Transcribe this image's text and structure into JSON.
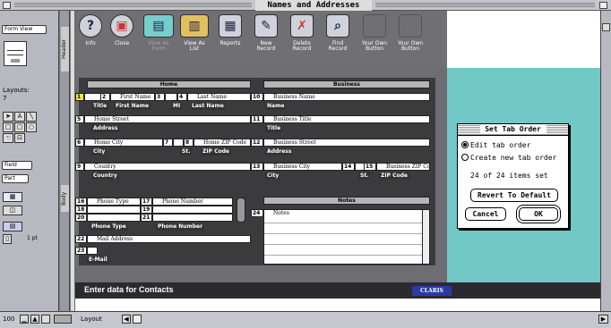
{
  "window": {
    "title": "Names and Addresses"
  },
  "left_panel": {
    "mode_popup": "Form View",
    "layouts_label": "Layouts:",
    "layouts_count": "7",
    "field_popup": "Field",
    "part_popup": "Part",
    "line_width": "1 pt"
  },
  "vertical_labels": {
    "header": "Header",
    "body": "Body"
  },
  "toolbar": {
    "buttons": [
      {
        "label": "Info",
        "icon": "?"
      },
      {
        "label": "Close",
        "icon": "▣"
      },
      {
        "label": "View As\nForm",
        "icon": "▤"
      },
      {
        "label": "View As\nList",
        "icon": "▥"
      },
      {
        "label": "Reports",
        "icon": "▦"
      },
      {
        "label": "New\nRecord",
        "icon": "✎"
      },
      {
        "label": "Delete\nRecord",
        "icon": "✗"
      },
      {
        "label": "Find\nRecord",
        "icon": "⌕"
      },
      {
        "label": "Your Own\nButton",
        "icon": ""
      },
      {
        "label": "Your Own\nButton",
        "icon": ""
      }
    ]
  },
  "form": {
    "home_header": "Home",
    "business_header": "Business",
    "notes_header": "Notes",
    "fields": {
      "f1": {
        "num": "1",
        "text": ""
      },
      "f2": {
        "num": "2",
        "text": "First Name"
      },
      "f3": {
        "num": "3",
        "text": ""
      },
      "f4": {
        "num": "4",
        "text": "Last Name"
      },
      "f5": {
        "num": "5",
        "text": "Home Street"
      },
      "f6": {
        "num": "6",
        "text": "Home City"
      },
      "f7": {
        "num": "7",
        "text": ""
      },
      "f8": {
        "num": "8",
        "text": "Home ZIP Code"
      },
      "f9": {
        "num": "9",
        "text": "Country"
      },
      "f10": {
        "num": "10",
        "text": "Business Name"
      },
      "f11": {
        "num": "11",
        "text": "Business Title"
      },
      "f12": {
        "num": "12",
        "text": "Business Street"
      },
      "f13": {
        "num": "13",
        "text": "Business City"
      },
      "f14": {
        "num": "14",
        "text": ""
      },
      "f15": {
        "num": "15",
        "text": "Business ZIP Code"
      },
      "f16": {
        "num": "16",
        "text": "Phone Type"
      },
      "f17": {
        "num": "17",
        "text": "Phone Number"
      },
      "f18": {
        "num": "18",
        "text": ""
      },
      "f19": {
        "num": "19",
        "text": ""
      },
      "f20": {
        "num": "20",
        "text": ""
      },
      "f21": {
        "num": "21",
        "text": ""
      },
      "f22": {
        "num": "22",
        "text": "Mail Address"
      },
      "f23": {
        "num": "23",
        "text": ""
      },
      "f24": {
        "num": "24",
        "text": "Notes"
      }
    },
    "labels": {
      "title": "Title",
      "first_name": "First Name",
      "mi": "MI",
      "last_name": "Last Name",
      "address": "Address",
      "city": "City",
      "st": "St.",
      "zip": "ZIP Code",
      "country": "Country",
      "name": "Name",
      "btitle": "Title",
      "baddress": "Address",
      "bcity": "City",
      "bst": "St.",
      "bzip": "ZIP Code",
      "phone_type": "Phone Type",
      "phone_number": "Phone Number",
      "email": "E-Mail"
    }
  },
  "dialog": {
    "title": "Set Tab Order",
    "option_edit": "Edit tab order",
    "option_create": "Create new tab order",
    "items_set": "24 of 24 items set",
    "revert_button": "Revert To Default",
    "cancel_button": "Cancel",
    "ok_button": "OK"
  },
  "status": {
    "text": "Enter data for Contacts",
    "brand": "CLARIS"
  },
  "bottom_bar": {
    "zoom": "100",
    "mode": "Layout"
  }
}
